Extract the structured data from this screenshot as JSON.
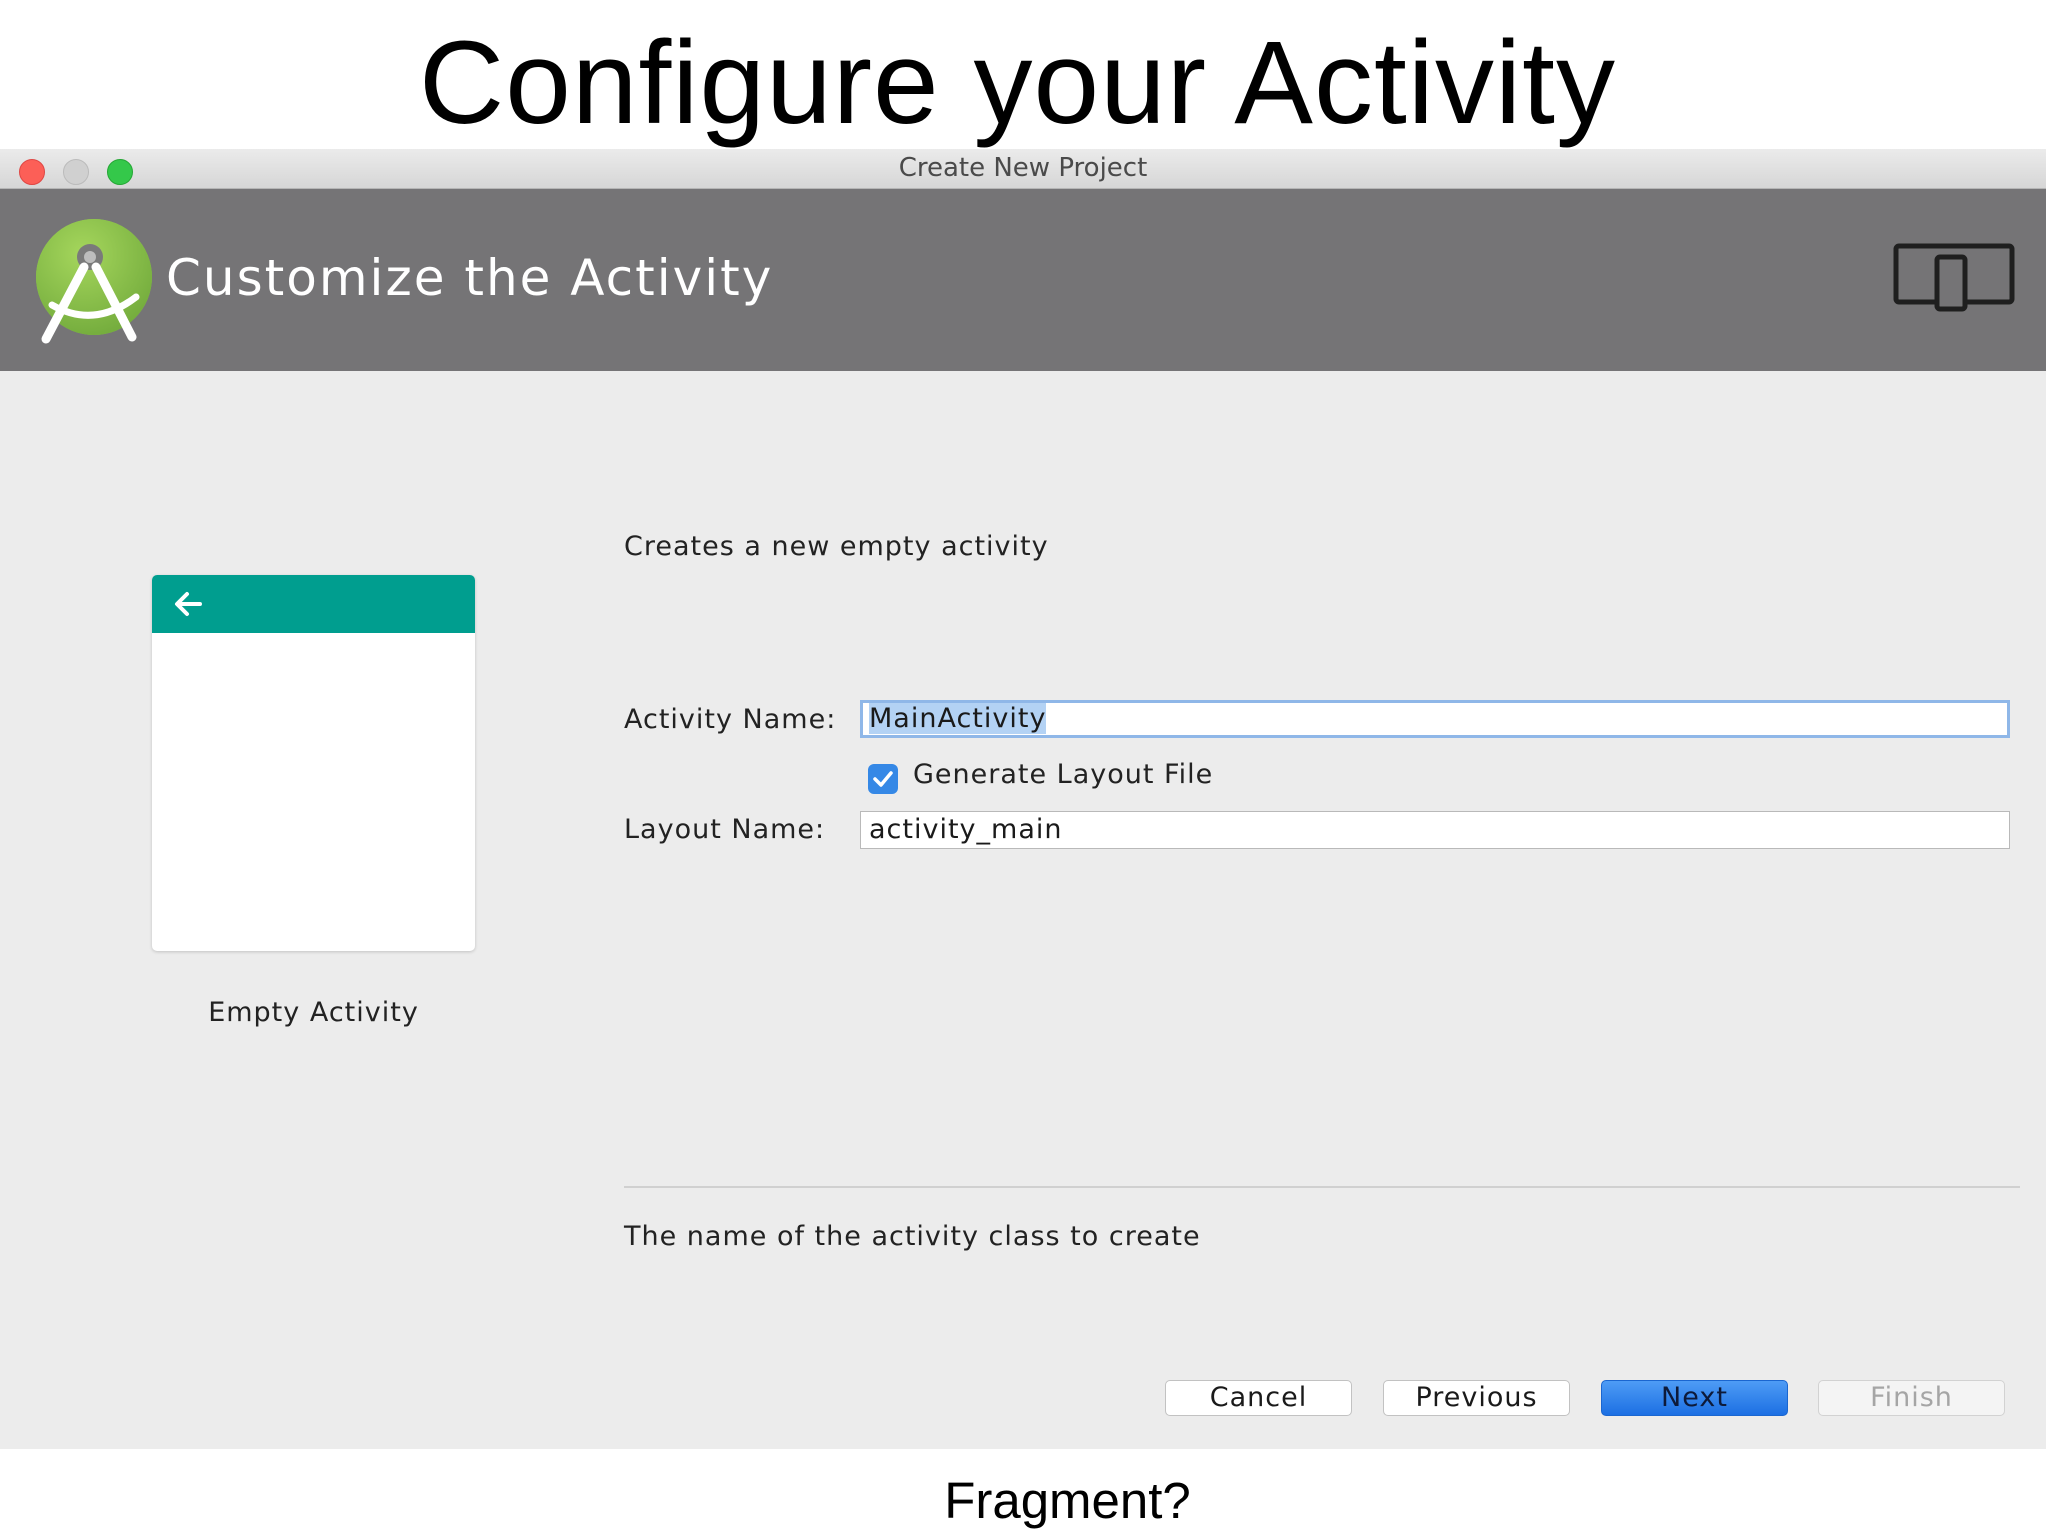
{
  "slide": {
    "title": "Configure your Activity",
    "caption": "Fragment?"
  },
  "window": {
    "title": "Create New Project",
    "buttons": [
      "close",
      "minimize",
      "maximize"
    ]
  },
  "header": {
    "title": "Customize the Activity",
    "logo_icon": "android-studio-logo",
    "device_icon": "tablet-phone-icon",
    "background_color": "#757476"
  },
  "template": {
    "name": "Empty Activity",
    "preview_bar_color": "#009e8f",
    "description": "Creates a new empty activity"
  },
  "form": {
    "activity_name_label": "Activity Name:",
    "activity_name_value": "MainActivity",
    "generate_layout_label": "Generate Layout File",
    "generate_layout_checked": true,
    "layout_name_label": "Layout Name:",
    "layout_name_value": "activity_main"
  },
  "help": {
    "text": "The name of the activity class to create"
  },
  "buttons": {
    "cancel": "Cancel",
    "previous": "Previous",
    "next": "Next",
    "finish": "Finish"
  }
}
